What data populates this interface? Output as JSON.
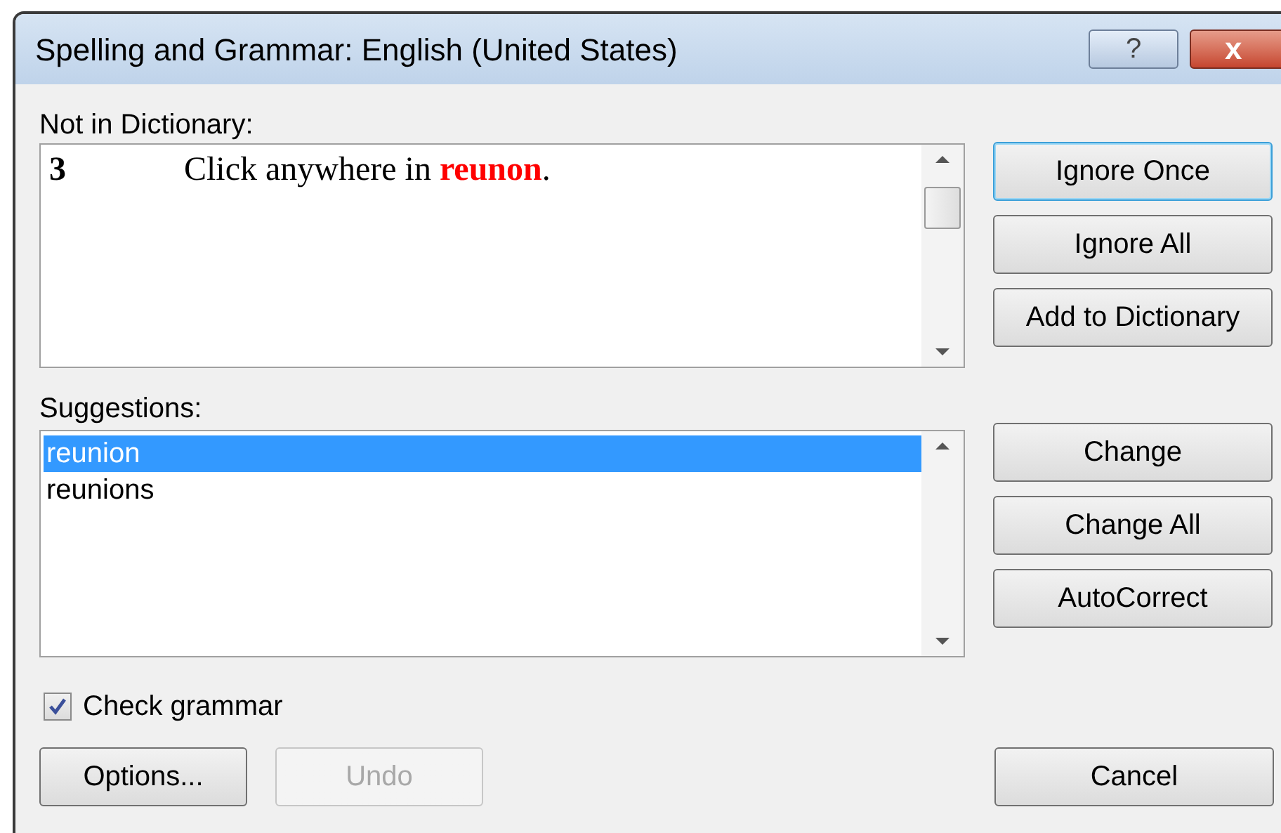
{
  "window": {
    "title": "Spelling and Grammar: English (United States)",
    "help_button": "?",
    "close_button": "x"
  },
  "not_in_dictionary": {
    "label": "Not in Dictionary:",
    "line_number": "3",
    "before": "Click anywhere in ",
    "error_word": "reunon",
    "after": "."
  },
  "top_buttons": [
    {
      "label": "Ignore Once",
      "focused": true
    },
    {
      "label": "Ignore All",
      "focused": false
    },
    {
      "label": "Add to Dictionary",
      "focused": false
    }
  ],
  "suggestions": {
    "label": "Suggestions:",
    "items": [
      {
        "text": "reunion",
        "selected": true
      },
      {
        "text": "reunions",
        "selected": false
      }
    ]
  },
  "change_buttons": [
    {
      "label": "Change",
      "focused": false
    },
    {
      "label": "Change All",
      "focused": false
    },
    {
      "label": "AutoCorrect",
      "focused": false
    }
  ],
  "check_grammar": {
    "label": "Check grammar",
    "checked": true
  },
  "bottom_buttons": [
    {
      "label": "Options...",
      "disabled": false
    },
    {
      "label": "Undo",
      "disabled": true
    }
  ],
  "cancel_button": {
    "label": "Cancel",
    "disabled": false
  }
}
